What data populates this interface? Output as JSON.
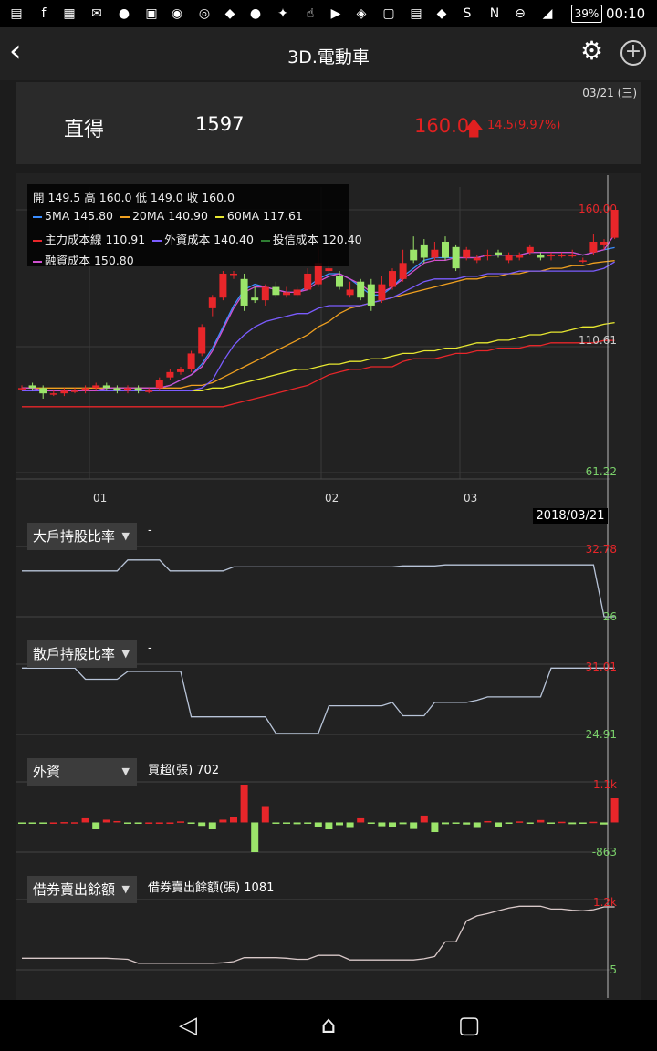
{
  "status_bar": {
    "battery": "39%",
    "time": "00:10"
  },
  "header": {
    "title": "3D.電動車"
  },
  "quote": {
    "date": "03/21 (三)",
    "name": "直得",
    "code": "1597",
    "price": "160.0",
    "change": "14.5(9.97%)"
  },
  "legend": {
    "ohlc": "開 149.5 高 160.0 低 149.0 收 160.0",
    "ma5": "5MA 145.80",
    "ma20": "20MA 140.90",
    "ma60": "60MA 117.61",
    "main_cost": "主力成本線 110.91",
    "foreign_cost": "外資成本 140.40",
    "trust_cost": "投信成本 120.40",
    "margin_cost": "融資成本 150.80"
  },
  "colors": {
    "up": "#e8262a",
    "down": "#9be56a",
    "ma5": "#3a8dff",
    "ma20": "#f0a020",
    "ma60": "#e8e830",
    "main": "#e8262a",
    "foreign": "#7b5cff",
    "trust": "#2e7d32",
    "margin": "#d050d0"
  },
  "price_axis": {
    "high": "160.00",
    "mid": "110.61",
    "low": "61.22"
  },
  "months": [
    "01",
    "02",
    "03"
  ],
  "cursor_date": "2018/03/21",
  "indicators": [
    {
      "name": "大戶持股比率",
      "value": "-",
      "axis_top": "32.78",
      "axis_bottom": "26"
    },
    {
      "name": "散戶持股比率",
      "value": "-",
      "axis_top": "31.01",
      "axis_bottom": "24.91"
    },
    {
      "name": "外資",
      "value": "買超(張) 702",
      "axis_top": "1.1k",
      "axis_bottom": "-863"
    },
    {
      "name": "借券賣出餘額",
      "value": "借券賣出餘額(張) 1081",
      "axis_top": "1.2k",
      "axis_bottom": "5"
    }
  ],
  "chart_data": [
    {
      "type": "candlestick",
      "title": "",
      "ylim": [
        61.22,
        160.0
      ],
      "months": [
        "01",
        "02",
        "03"
      ],
      "candles": [
        {
          "o": 93,
          "c": 93,
          "h": 94,
          "l": 92
        },
        {
          "o": 94,
          "c": 93,
          "h": 95,
          "l": 92
        },
        {
          "o": 93,
          "c": 91,
          "h": 94,
          "l": 89
        },
        {
          "o": 91,
          "c": 91,
          "h": 92,
          "l": 90
        },
        {
          "o": 91,
          "c": 92,
          "h": 93,
          "l": 90
        },
        {
          "o": 92,
          "c": 92,
          "h": 93,
          "l": 91
        },
        {
          "o": 92,
          "c": 93,
          "h": 94,
          "l": 91
        },
        {
          "o": 93,
          "c": 94,
          "h": 95,
          "l": 92
        },
        {
          "o": 94,
          "c": 93,
          "h": 95,
          "l": 92
        },
        {
          "o": 93,
          "c": 92,
          "h": 94,
          "l": 91
        },
        {
          "o": 92,
          "c": 93,
          "h": 94,
          "l": 91
        },
        {
          "o": 93,
          "c": 92,
          "h": 94,
          "l": 91
        },
        {
          "o": 92,
          "c": 92,
          "h": 93,
          "l": 91
        },
        {
          "o": 93,
          "c": 96,
          "h": 97,
          "l": 92
        },
        {
          "o": 97,
          "c": 99,
          "h": 100,
          "l": 96
        },
        {
          "o": 99,
          "c": 100,
          "h": 101,
          "l": 98
        },
        {
          "o": 100,
          "c": 106,
          "h": 107,
          "l": 99
        },
        {
          "o": 106,
          "c": 116,
          "h": 117,
          "l": 105
        },
        {
          "o": 123,
          "c": 127,
          "h": 128,
          "l": 120
        },
        {
          "o": 127,
          "c": 136,
          "h": 137,
          "l": 126
        },
        {
          "o": 136,
          "c": 136,
          "h": 137,
          "l": 134
        },
        {
          "o": 134,
          "c": 124,
          "h": 136,
          "l": 122
        },
        {
          "o": 127,
          "c": 126,
          "h": 131,
          "l": 125
        },
        {
          "o": 126,
          "c": 131,
          "h": 132,
          "l": 124
        },
        {
          "o": 131,
          "c": 128,
          "h": 133,
          "l": 127
        },
        {
          "o": 128,
          "c": 129,
          "h": 131,
          "l": 127
        },
        {
          "o": 128,
          "c": 130,
          "h": 131,
          "l": 127
        },
        {
          "o": 130,
          "c": 136,
          "h": 138,
          "l": 130
        },
        {
          "o": 132,
          "c": 140,
          "h": 146,
          "l": 131
        },
        {
          "o": 137,
          "c": 138,
          "h": 141,
          "l": 136
        },
        {
          "o": 135,
          "c": 131,
          "h": 137,
          "l": 130
        },
        {
          "o": 128,
          "c": 130,
          "h": 133,
          "l": 127
        },
        {
          "o": 133,
          "c": 127,
          "h": 134,
          "l": 126
        },
        {
          "o": 132,
          "c": 124,
          "h": 134,
          "l": 122
        },
        {
          "o": 126,
          "c": 132,
          "h": 135,
          "l": 125
        },
        {
          "o": 131,
          "c": 137,
          "h": 138,
          "l": 130
        },
        {
          "o": 134,
          "c": 140,
          "h": 145,
          "l": 133
        },
        {
          "o": 145,
          "c": 141,
          "h": 150,
          "l": 140
        },
        {
          "o": 147,
          "c": 142,
          "h": 149,
          "l": 140
        },
        {
          "o": 142,
          "c": 145,
          "h": 148,
          "l": 141
        },
        {
          "o": 148,
          "c": 142,
          "h": 150,
          "l": 141
        },
        {
          "o": 146,
          "c": 138,
          "h": 147,
          "l": 137
        },
        {
          "o": 142,
          "c": 145,
          "h": 146,
          "l": 141
        },
        {
          "o": 141,
          "c": 142,
          "h": 143,
          "l": 140
        },
        {
          "o": 143,
          "c": 143,
          "h": 145,
          "l": 141
        },
        {
          "o": 144,
          "c": 143,
          "h": 145,
          "l": 142
        },
        {
          "o": 141,
          "c": 143,
          "h": 144,
          "l": 140
        },
        {
          "o": 142,
          "c": 143,
          "h": 144,
          "l": 141
        },
        {
          "o": 144,
          "c": 146,
          "h": 147,
          "l": 143
        },
        {
          "o": 143,
          "c": 142,
          "h": 144,
          "l": 141
        },
        {
          "o": 143,
          "c": 143,
          "h": 144,
          "l": 141
        },
        {
          "o": 143,
          "c": 143,
          "h": 144,
          "l": 142
        },
        {
          "o": 143,
          "c": 143,
          "h": 145,
          "l": 142
        },
        {
          "o": 141,
          "c": 141,
          "h": 142,
          "l": 140
        },
        {
          "o": 144,
          "c": 148,
          "h": 151,
          "l": 143
        },
        {
          "o": 147,
          "c": 148,
          "h": 149,
          "l": 145
        },
        {
          "o": 149.5,
          "c": 160,
          "h": 160,
          "l": 149
        }
      ],
      "series": [
        {
          "name": "5MA",
          "values": [
            93,
            93,
            92,
            92,
            92,
            92,
            92,
            92,
            93,
            93,
            93,
            93,
            93,
            93,
            94,
            96,
            98,
            102,
            108,
            116,
            124,
            130,
            132,
            131,
            130,
            129,
            129,
            131,
            134,
            136,
            136,
            134,
            131,
            128,
            128,
            131,
            135,
            138,
            141,
            142,
            142,
            142,
            142,
            142,
            143,
            143,
            143,
            143,
            144,
            144,
            144,
            144,
            144,
            143,
            144,
            145,
            145.8
          ]
        },
        {
          "name": "20MA",
          "values": [
            93,
            93,
            93,
            93,
            93,
            93,
            93,
            93,
            93,
            93,
            93,
            93,
            93,
            93,
            93,
            93,
            94,
            94,
            95,
            97,
            99,
            101,
            103,
            105,
            107,
            109,
            111,
            113,
            116,
            118,
            121,
            123,
            124,
            125,
            126,
            127,
            128,
            129,
            130,
            131,
            132,
            133,
            134,
            134,
            135,
            135,
            136,
            136,
            137,
            137,
            138,
            138,
            139,
            139,
            140,
            140.5,
            140.9
          ]
        },
        {
          "name": "60MA",
          "values": [
            92,
            92,
            92,
            92,
            92,
            92,
            92,
            92,
            92,
            92,
            92,
            92,
            92,
            92,
            92,
            92,
            92,
            92,
            93,
            93,
            94,
            95,
            96,
            97,
            98,
            99,
            100,
            100,
            101,
            102,
            102,
            103,
            103,
            104,
            104,
            105,
            106,
            106,
            107,
            107,
            108,
            108,
            109,
            110,
            110,
            111,
            111,
            112,
            113,
            113,
            114,
            114,
            115,
            116,
            116,
            117,
            117.61
          ]
        },
        {
          "name": "主力成本線",
          "values": [
            86,
            86,
            86,
            86,
            86,
            86,
            86,
            86,
            86,
            86,
            86,
            86,
            86,
            86,
            86,
            86,
            86,
            86,
            86,
            86,
            87,
            88,
            89,
            90,
            91,
            92,
            93,
            94,
            96,
            98,
            99,
            100,
            100,
            101,
            101,
            101,
            103,
            104,
            104,
            104,
            105,
            106,
            106,
            107,
            107,
            108,
            108,
            108,
            109,
            109,
            110,
            110,
            110,
            110,
            110,
            110.9,
            110.91
          ]
        },
        {
          "name": "外資成本",
          "values": [
            92,
            92,
            92,
            92,
            92,
            92,
            92,
            92,
            92,
            92,
            92,
            92,
            92,
            92,
            92,
            92,
            92,
            93,
            96,
            103,
            109,
            113,
            116,
            118,
            119,
            120,
            121,
            121,
            123,
            124,
            124,
            124,
            124,
            125,
            126,
            127,
            129,
            131,
            133,
            134,
            134,
            134,
            135,
            135,
            136,
            136,
            136,
            137,
            137,
            137,
            137,
            137,
            137,
            137,
            137,
            138,
            140.4
          ]
        },
        {
          "name": "融資成本",
          "values": [
            93,
            93,
            92,
            92,
            92,
            92,
            92,
            92,
            93,
            93,
            93,
            93,
            93,
            93,
            94,
            96,
            98,
            101,
            107,
            115,
            123,
            129,
            131,
            131,
            130,
            129,
            129,
            130,
            133,
            135,
            136,
            134,
            132,
            129,
            129,
            131,
            134,
            137,
            140,
            141,
            141,
            142,
            142,
            142,
            143,
            143,
            143,
            143,
            144,
            144,
            144,
            144,
            144,
            143,
            144,
            145,
            150.8
          ]
        }
      ]
    },
    {
      "type": "line",
      "title": "大戶持股比率",
      "ylim": [
        26,
        32.78
      ],
      "values": [
        30.6,
        30.6,
        30.6,
        30.6,
        30.6,
        30.6,
        30.6,
        30.6,
        30.6,
        30.6,
        31.7,
        31.7,
        31.7,
        31.7,
        30.6,
        30.6,
        30.6,
        30.6,
        30.6,
        30.6,
        31.0,
        31.0,
        31.0,
        31.0,
        31.0,
        31.0,
        31.0,
        31.0,
        31.0,
        31.0,
        31.0,
        31.0,
        31.0,
        31.0,
        31.0,
        31.0,
        31.1,
        31.1,
        31.1,
        31.1,
        31.2,
        31.2,
        31.2,
        31.2,
        31.2,
        31.2,
        31.2,
        31.2,
        31.2,
        31.2,
        31.2,
        31.2,
        31.2,
        31.2,
        31.2,
        26,
        26
      ]
    },
    {
      "type": "line",
      "title": "散戶持股比率",
      "ylim": [
        24.91,
        31.01
      ],
      "values": [
        30.9,
        30.9,
        30.9,
        30.9,
        30.9,
        30.9,
        29.9,
        29.9,
        29.9,
        29.9,
        30.6,
        30.6,
        30.6,
        30.6,
        30.6,
        30.6,
        26.5,
        26.5,
        26.5,
        26.5,
        26.5,
        26.5,
        26.5,
        26.5,
        25.0,
        25.0,
        25.0,
        25.0,
        25.0,
        27.5,
        27.5,
        27.5,
        27.5,
        27.5,
        27.5,
        27.8,
        26.6,
        26.6,
        26.6,
        27.8,
        27.8,
        27.8,
        27.8,
        28.0,
        28.3,
        28.3,
        28.3,
        28.3,
        28.3,
        28.3,
        30.9,
        30.9,
        30.9,
        30.9,
        30.9,
        30.9,
        30.9
      ]
    },
    {
      "type": "bar",
      "title": "外資",
      "ylim": [
        -863,
        1100
      ],
      "values": [
        -20,
        -20,
        -10,
        0,
        10,
        5,
        120,
        -200,
        80,
        40,
        -20,
        -10,
        0,
        0,
        0,
        30,
        -40,
        -100,
        -200,
        80,
        160,
        1100,
        -863,
        450,
        -30,
        -10,
        -50,
        -30,
        -140,
        -200,
        -80,
        -160,
        120,
        -40,
        -110,
        -140,
        -50,
        -190,
        200,
        -280,
        -50,
        -10,
        -60,
        -160,
        40,
        -120,
        -40,
        30,
        -10,
        70,
        -30,
        20,
        -50,
        -40,
        20,
        -60,
        702
      ]
    },
    {
      "type": "line",
      "title": "借券賣出餘額",
      "ylim": [
        5,
        1200
      ],
      "values": [
        210,
        210,
        210,
        210,
        210,
        210,
        210,
        210,
        210,
        200,
        190,
        120,
        120,
        120,
        120,
        120,
        120,
        120,
        120,
        130,
        150,
        220,
        220,
        220,
        220,
        210,
        190,
        190,
        260,
        260,
        260,
        180,
        180,
        180,
        180,
        180,
        180,
        180,
        200,
        240,
        500,
        500,
        870,
        960,
        1000,
        1050,
        1100,
        1130,
        1130,
        1130,
        1080,
        1080,
        1060,
        1050,
        1070,
        1120,
        1120
      ]
    }
  ]
}
